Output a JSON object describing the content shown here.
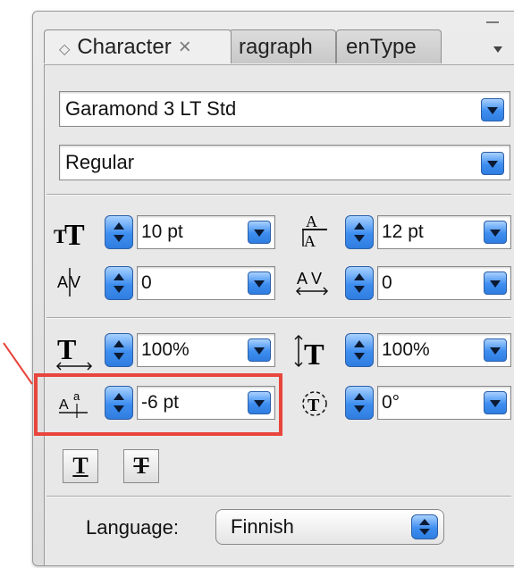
{
  "tabs": [
    {
      "label": "Character",
      "active": true
    },
    {
      "label": "ragraph",
      "active": false
    },
    {
      "label": "enType",
      "active": false
    }
  ],
  "font_family": "Garamond 3 LT Std",
  "font_style": "Regular",
  "controls": {
    "font_size": "10 pt",
    "leading": "12 pt",
    "kerning": "0",
    "tracking": "0",
    "horizontal_scale": "100%",
    "vertical_scale": "100%",
    "baseline_shift": "-6 pt",
    "character_rotation": "0°"
  },
  "language": {
    "label": "Language:",
    "value": "Finnish"
  },
  "icons": {
    "font_size": "font-size-icon",
    "leading": "leading-icon",
    "kerning": "kerning-icon",
    "tracking": "tracking-icon",
    "horizontal_scale": "horizontal-scale-icon",
    "vertical_scale": "vertical-scale-icon",
    "baseline_shift": "baseline-shift-icon",
    "rotation": "character-rotation-icon"
  },
  "colors": {
    "accent": "#3e8ef0",
    "highlight": "#e8453c"
  }
}
